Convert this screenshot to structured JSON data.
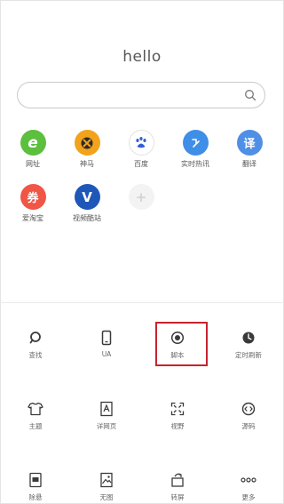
{
  "title": "hello",
  "search": {
    "placeholder": "",
    "value": ""
  },
  "sites": [
    {
      "label": "网址",
      "icon": "browser-e-icon",
      "glyph": "e",
      "color": "#5cbf3e"
    },
    {
      "label": "神马",
      "icon": "shenma-icon",
      "glyph": "",
      "color": "#f2a31b"
    },
    {
      "label": "百度",
      "icon": "baidu-paw-icon",
      "glyph": "",
      "color": "#ffffff"
    },
    {
      "label": "实时热讯",
      "icon": "hotnews-icon",
      "glyph": "",
      "color": "#3f8ee8"
    },
    {
      "label": "翻译",
      "icon": "translate-icon",
      "glyph": "译",
      "color": "#4f8fe6"
    },
    {
      "label": "爱淘宝",
      "icon": "taobao-icon",
      "glyph": "券",
      "color": "#f05546"
    },
    {
      "label": "视频酷站",
      "icon": "video-site-icon",
      "glyph": "V",
      "color": "#1f57b8"
    },
    {
      "label": "",
      "icon": "add-site-icon",
      "glyph": "+",
      "color": "#f3f3f3"
    }
  ],
  "tools": [
    {
      "label": "查找",
      "icon": "find-icon"
    },
    {
      "label": "UA",
      "icon": "phone-ua-icon"
    },
    {
      "label": "脚本",
      "icon": "script-record-icon"
    },
    {
      "label": "定时刷新",
      "icon": "clock-icon"
    },
    {
      "label": "主题",
      "icon": "shirt-theme-icon"
    },
    {
      "label": "详网页",
      "icon": "page-detail-icon"
    },
    {
      "label": "视野",
      "icon": "expand-view-icon"
    },
    {
      "label": "源码",
      "icon": "source-code-icon"
    },
    {
      "label": "除悬",
      "icon": "floating-remove-icon"
    },
    {
      "label": "无图",
      "icon": "no-image-icon"
    },
    {
      "label": "转屏",
      "icon": "rotate-screen-icon"
    },
    {
      "label": "更多",
      "icon": "more-icon"
    }
  ]
}
